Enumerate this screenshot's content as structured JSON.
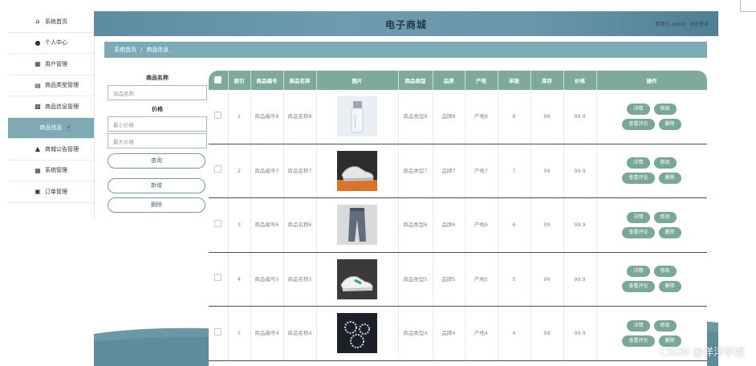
{
  "header": {
    "title": "电子商城",
    "user_role": "管理员 admin",
    "logout": "退出登录"
  },
  "sidebar": {
    "items": [
      {
        "label": "系统首页",
        "icon": "home-icon"
      },
      {
        "label": "个人中心",
        "icon": "user-icon"
      },
      {
        "label": "用户管理",
        "icon": "grid-icon"
      },
      {
        "label": "商品类型管理",
        "icon": "clipboard-icon"
      },
      {
        "label": "商品信息管理",
        "icon": "bar-chart-icon"
      },
      {
        "label": "商品信息",
        "icon": "",
        "active": true
      },
      {
        "label": "商城公告管理",
        "icon": "megaphone-icon"
      },
      {
        "label": "系统管理",
        "icon": "grid-icon"
      },
      {
        "label": "订单管理",
        "icon": "monitor-icon"
      }
    ]
  },
  "breadcrumb": {
    "home": "系统首页",
    "separator": "/",
    "current": "商品信息"
  },
  "search": {
    "name_label": "商品名称",
    "name_placeholder": "商品名称",
    "price_label": "价格",
    "min_price_placeholder": "最小价格",
    "max_price_placeholder": "最大价格",
    "query_button": "查询",
    "add_button": "新增",
    "delete_button": "删除"
  },
  "table": {
    "headers": [
      "",
      "索引",
      "商品编号",
      "商品名称",
      "图片",
      "商品类型",
      "品牌",
      "产地",
      "单限",
      "库存",
      "价格",
      "操作"
    ],
    "actions": {
      "detail": "详情",
      "edit": "修改",
      "reviews": "查看评论",
      "delete": "删除"
    },
    "rows": [
      {
        "index": "1",
        "code": "商品编号8",
        "name": "商品名称8",
        "type": "商品类型8",
        "brand": "品牌8",
        "origin": "产地8",
        "limit": "8",
        "stock": "99",
        "price": "99.9",
        "image": "bottle"
      },
      {
        "index": "2",
        "code": "商品编号7",
        "name": "商品名称7",
        "type": "商品类型7",
        "brand": "品牌7",
        "origin": "产地7",
        "limit": "7",
        "stock": "99",
        "price": "99.9",
        "image": "sneaker-orange"
      },
      {
        "index": "3",
        "code": "商品编号6",
        "name": "商品名称6",
        "type": "商品类型6",
        "brand": "品牌6",
        "origin": "产地6",
        "limit": "6",
        "stock": "99",
        "price": "99.9",
        "image": "pants"
      },
      {
        "index": "4",
        "code": "商品编号5",
        "name": "商品名称5",
        "type": "商品类型5",
        "brand": "品牌5",
        "origin": "产地5",
        "limit": "5",
        "stock": "99",
        "price": "99.9",
        "image": "sneaker-teal"
      },
      {
        "index": "5",
        "code": "商品编号4",
        "name": "商品名称4",
        "type": "商品类型4",
        "brand": "品牌4",
        "origin": "产地4",
        "limit": "4",
        "stock": "99",
        "price": "99.9",
        "image": "jewelry"
      }
    ]
  },
  "watermark": "CSDN @洋洋学姐",
  "colors": {
    "header": "#6a96aa",
    "accent": "#7eaa9a",
    "sidebar_active": "#7eaab4",
    "breadcrumb": "#7aabb7"
  }
}
